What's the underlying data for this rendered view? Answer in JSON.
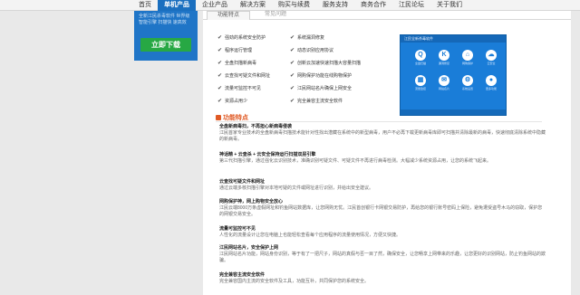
{
  "nav": {
    "items": [
      "首页",
      "单机产品",
      "企业产品",
      "解决方案",
      "购买与续费",
      "服务支持",
      "商务合作",
      "江民论坛",
      "关于我们"
    ],
    "active_index": 1
  },
  "sidebar": {
    "desc": "全新江民杀毒软件 世界级智能引擎 扫描快 速高效",
    "download_label": "立即下载"
  },
  "tabs": [
    "功能特点",
    "常见问题"
  ],
  "features": [
    "强劲的系统安全防护",
    "系统漏洞修复",
    "程序运行管理",
    "动态识别应用协议",
    "全盘扫描新病毒",
    "创新云加速快速扫描大容量扫描",
    "云查找可疑文件和网址",
    "网购保护功能在线购物保护",
    "流量可监控不可见",
    "江民网站名片确保上网安全",
    "资源占用少",
    "完全兼容主流安全软件"
  ],
  "screenshot": {
    "window_title": "江民全新杀毒软件",
    "icons": [
      {
        "glyph": "Q",
        "label": "全盘扫描"
      },
      {
        "glyph": "K",
        "label": "漏洞修复"
      },
      {
        "glyph": "⌂",
        "label": "网购保护"
      },
      {
        "glyph": "☁",
        "label": "云安全"
      },
      {
        "glyph": "▦",
        "label": "流量监控"
      },
      {
        "glyph": "✉",
        "label": "网站名片"
      },
      {
        "glyph": "⚙",
        "label": "系统设置"
      },
      {
        "glyph": "●",
        "label": "更多功能"
      }
    ]
  },
  "section": {
    "title": "功能特点"
  },
  "paragraphs": [
    {
      "heading": "全盘新病毒扫，不再担心新病毒侵袭",
      "body": "江民首家专业技术的全盘新病毒扫描技术能针对性找出潜藏在系统中的新型病毒，用户不必再下载更新病毒库即可扫描并清除最新的病毒，快速彻底清除系统中隐藏的新病毒。"
    },
    {
      "heading": "神话精 + 云查杀 + 云安全保持运行扫描双层引擎",
      "body": "第三代扫描引擎，通过强化云识别技术，准确识别可疑文件、可疑文件不再进行病毒检测。大幅减少系统资源占用，让您的系统飞起来。"
    },
    {
      "heading": "云查找可疑文件和网址",
      "body": "通过云端多核扫描引擎对本地可疑的文件或网址进行识别，并给出安全建议。"
    },
    {
      "heading": "网购保护神，网上购物安全放心",
      "body": "江民云端8000万条虚假网址和钓鱼网站数据库，让您网购无忧。江民首创银行卡网银交易防护，再给您的银行账号密码上保险，避免遭受盗号木马的窃取，保护您的网银交易安全。"
    },
    {
      "heading": "流量可监控可不见",
      "body": "人性化的流量设计让您在电脑上也能轻松查看每个应用程序的流量使用情况，方便又快捷。"
    },
    {
      "heading": "江民网站名片，安全保护上网",
      "body": "江民网站名片功能，网站身份识别，等于有了一把尺子，网站的真假与否一目了然，确保安全，让您畅享上网带来的乐趣，让您更好的识别网站，防止钓鱼网站的欺骗。"
    },
    {
      "heading": "完全兼容主流安全软件",
      "body": "完全兼容国内主流的安全软件及工具，功能互补，共同保护您的系统安全。"
    }
  ]
}
